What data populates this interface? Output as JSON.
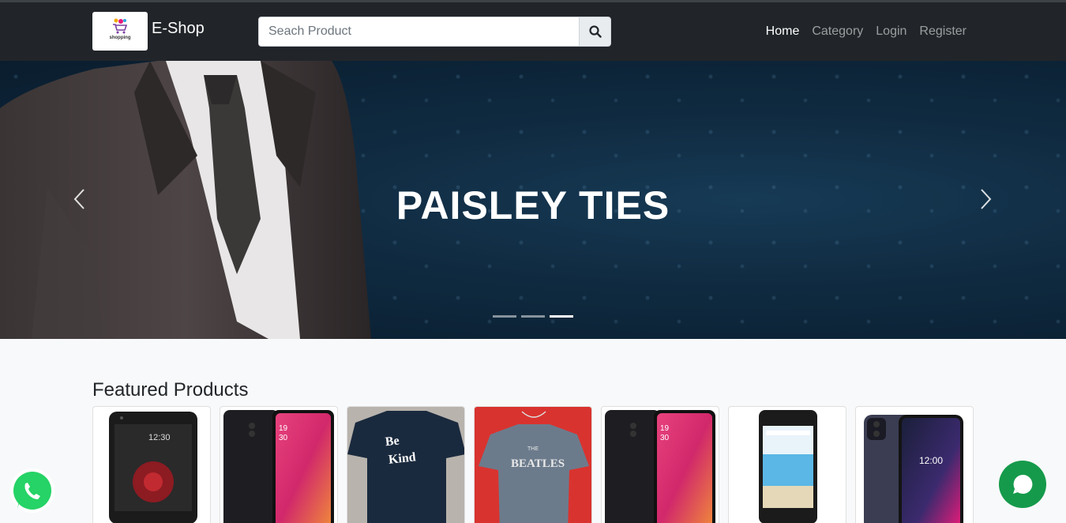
{
  "navbar": {
    "brand_name": "E-Shop",
    "logo_text": "shopping",
    "search_placeholder": "Seach Product",
    "nav": [
      {
        "label": "Home",
        "active": true
      },
      {
        "label": "Category",
        "active": false
      },
      {
        "label": "Login",
        "active": false
      },
      {
        "label": "Register",
        "active": false
      }
    ]
  },
  "carousel": {
    "caption": "PAISLEY TIES",
    "slide_count": 3,
    "active_slide": 3
  },
  "featured": {
    "title": "Featured Products",
    "products": [
      {
        "image": "black-smartphone-flower-wallpaper"
      },
      {
        "image": "oppo-smartphone-pink-gradient"
      },
      {
        "image": "be-kind-navy-tshirt"
      },
      {
        "image": "beatles-gray-tshirt"
      },
      {
        "image": "oppo-smartphone-pink-gradient"
      },
      {
        "image": "smartphone-beach-wallpaper"
      },
      {
        "image": "tmobile-smartphone-purple"
      }
    ]
  },
  "product_texts": {
    "be_kind": [
      "Be",
      "Kind"
    ],
    "beatles": [
      "THE",
      "BEATLES"
    ]
  },
  "colors": {
    "navbar_bg": "#212529",
    "chat_bg": "#159a4b",
    "whatsapp_green": "#25d366"
  }
}
